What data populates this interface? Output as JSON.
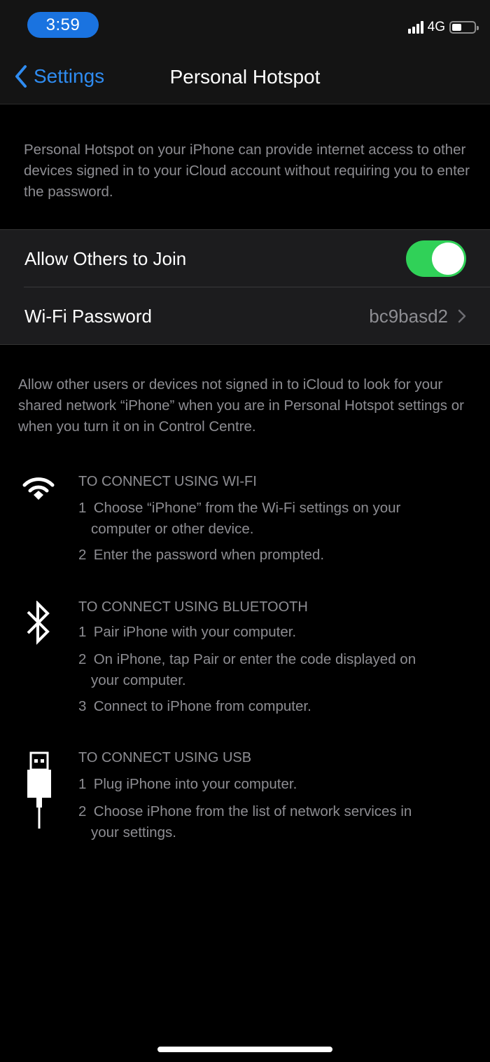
{
  "status_bar": {
    "time": "3:59",
    "network_type": "4G",
    "signal_icon": "cellular-signal-icon",
    "battery_icon": "battery-icon"
  },
  "nav": {
    "back_label": "Settings",
    "back_icon": "chevron-left-icon",
    "title": "Personal Hotspot"
  },
  "header_text": "Personal Hotspot on your iPhone can provide internet access to other devices signed in to your iCloud account without requiring you to enter the password.",
  "cells": {
    "allow_others": {
      "label": "Allow Others to Join",
      "enabled": true,
      "toggle_color": "#30d158"
    },
    "wifi_password": {
      "label": "Wi-Fi Password",
      "value": "bc9basd2"
    }
  },
  "footer_text": "Allow other users or devices not signed in to iCloud to look for your shared network “iPhone” when you are in Personal Hotspot settings or when you turn it on in Control Centre.",
  "instructions": {
    "wifi": {
      "icon": "wifi-icon",
      "title": "TO CONNECT USING WI-FI",
      "steps": [
        {
          "num": "1",
          "line1": "Choose “iPhone” from the Wi-Fi settings on your",
          "line2": "computer or other device."
        },
        {
          "num": "2",
          "line1": "Enter the password when prompted.",
          "line2": ""
        }
      ]
    },
    "bluetooth": {
      "icon": "bluetooth-icon",
      "title": "TO CONNECT USING BLUETOOTH",
      "steps": [
        {
          "num": "1",
          "line1": "Pair iPhone with your computer.",
          "line2": ""
        },
        {
          "num": "2",
          "line1": "On iPhone, tap Pair or enter the code displayed on",
          "line2": "your computer."
        },
        {
          "num": "3",
          "line1": "Connect to iPhone from computer.",
          "line2": ""
        }
      ]
    },
    "usb": {
      "icon": "usb-icon",
      "title": "TO CONNECT USING USB",
      "steps": [
        {
          "num": "1",
          "line1": "Plug iPhone into your computer.",
          "line2": ""
        },
        {
          "num": "2",
          "line1": "Choose iPhone from the list of network services in",
          "line2": "your settings."
        }
      ]
    }
  },
  "colors": {
    "accent": "#2f8cf1",
    "time_pill": "#1a73e0",
    "toggle_on": "#30d158",
    "secondary_text": "#8d8d92"
  }
}
